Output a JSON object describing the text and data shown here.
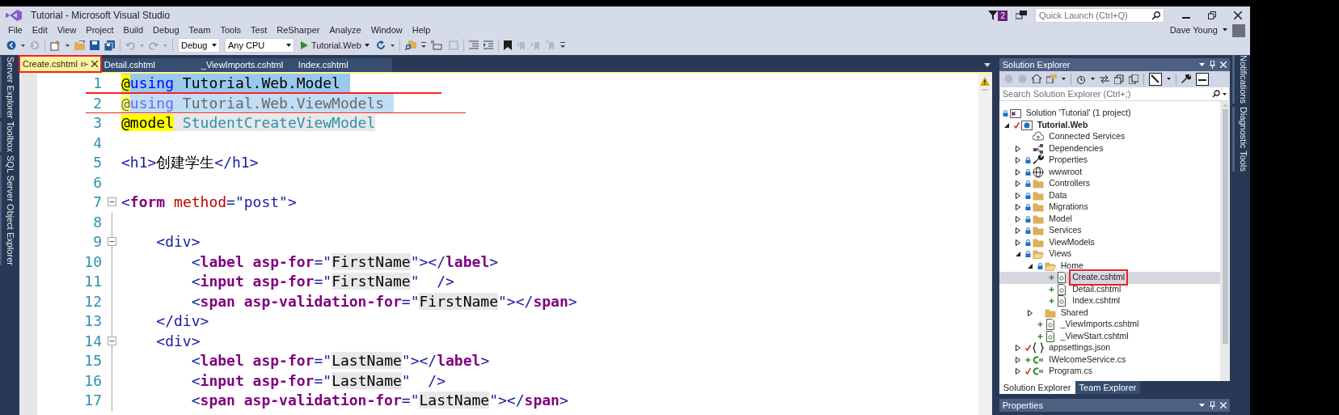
{
  "window": {
    "title": "Tutorial - Microsoft Visual Studio",
    "notification_count": "2",
    "quick_launch": {
      "placeholder": "Quick Launch (Ctrl+Q)"
    },
    "user": "Dave Young"
  },
  "menu": [
    "File",
    "Edit",
    "View",
    "Project",
    "Build",
    "Debug",
    "Team",
    "Tools",
    "Test",
    "ReSharper",
    "Analyze",
    "Window",
    "Help"
  ],
  "toolbar": {
    "configuration": "Debug",
    "platform": "Any CPU",
    "start_target": "Tutorial.Web"
  },
  "left_panels": [
    "Server Explorer",
    "Toolbox",
    "SQL Server Object Explorer"
  ],
  "right_panels": [
    "Notifications",
    "Diagnostic Tools"
  ],
  "tabs": [
    {
      "label": "Create.cshtml",
      "selected": true
    },
    {
      "label": "Detail.cshtml",
      "selected": false
    },
    {
      "label": "_ViewImports.cshtml",
      "selected": false
    },
    {
      "label": "Index.cshtml",
      "selected": false
    }
  ],
  "editor": {
    "lines": [
      {
        "number": "1",
        "selected": true,
        "faded": false,
        "struck": true,
        "fold": false,
        "tokens": [
          {
            "text": "@",
            "kind": "razor"
          },
          {
            "text": "using",
            "kind": "keyword"
          },
          {
            "text": " Tutorial.Web.Model",
            "kind": "plain"
          }
        ]
      },
      {
        "number": "2",
        "selected": true,
        "faded": true,
        "struck": true,
        "fold": false,
        "tokens": [
          {
            "text": "@",
            "kind": "razor"
          },
          {
            "text": "using",
            "kind": "keyword"
          },
          {
            "text": " Tutorial.Web.ViewModels",
            "kind": "plain"
          }
        ]
      },
      {
        "number": "3",
        "selected": false,
        "faded": false,
        "struck": false,
        "fold": false,
        "tokens": [
          {
            "text": "@model",
            "kind": "razor"
          },
          {
            "text": " StudentCreateViewModel",
            "kind": "type"
          }
        ]
      },
      {
        "number": "4",
        "selected": false,
        "faded": false,
        "struck": false,
        "fold": false
      },
      {
        "number": "5",
        "selected": false,
        "faded": false,
        "struck": false,
        "fold": false,
        "tokens": [
          {
            "text": "<h1>",
            "kind": "tag"
          },
          {
            "text": "创建学生",
            "kind": "plain"
          },
          {
            "text": "</h1>",
            "kind": "tag"
          }
        ]
      },
      {
        "number": "6",
        "selected": false,
        "faded": false,
        "struck": false,
        "fold": false
      },
      {
        "number": "7",
        "selected": false,
        "faded": false,
        "struck": false,
        "fold": true,
        "tokens": [
          {
            "text": "<",
            "kind": "tag"
          },
          {
            "text": "form",
            "kind": "helper"
          },
          {
            "text": " method",
            "kind": "attr"
          },
          {
            "text": "=\"post\">",
            "kind": "tag"
          }
        ]
      },
      {
        "number": "8",
        "selected": false,
        "faded": false,
        "struck": false,
        "fold": false
      },
      {
        "number": "9",
        "selected": false,
        "faded": false,
        "struck": false,
        "fold": true,
        "tokens": [
          {
            "text": "    <div>",
            "kind": "tag"
          }
        ]
      },
      {
        "number": "10",
        "selected": false,
        "faded": false,
        "struck": false,
        "fold": false,
        "tokens": [
          {
            "text": "        <",
            "kind": "tag"
          },
          {
            "text": "label asp-for",
            "kind": "helper"
          },
          {
            "text": "=\"",
            "kind": "tag"
          },
          {
            "text": "FirstName",
            "kind": "value"
          },
          {
            "text": "\"></",
            "kind": "tag"
          },
          {
            "text": "label",
            "kind": "helper"
          },
          {
            "text": ">",
            "kind": "tag"
          }
        ]
      },
      {
        "number": "11",
        "selected": false,
        "faded": false,
        "struck": false,
        "fold": false,
        "tokens": [
          {
            "text": "        <",
            "kind": "tag"
          },
          {
            "text": "input asp-for",
            "kind": "helper"
          },
          {
            "text": "=\"",
            "kind": "tag"
          },
          {
            "text": "FirstName",
            "kind": "value"
          },
          {
            "text": "\"  />",
            "kind": "tag"
          }
        ]
      },
      {
        "number": "12",
        "selected": false,
        "faded": false,
        "struck": false,
        "fold": false,
        "tokens": [
          {
            "text": "        <",
            "kind": "tag"
          },
          {
            "text": "span asp-validation-for",
            "kind": "helper"
          },
          {
            "text": "=\"",
            "kind": "tag"
          },
          {
            "text": "FirstName",
            "kind": "value"
          },
          {
            "text": "\"></",
            "kind": "tag"
          },
          {
            "text": "span",
            "kind": "helper"
          },
          {
            "text": ">",
            "kind": "tag"
          }
        ]
      },
      {
        "number": "13",
        "selected": false,
        "faded": false,
        "struck": false,
        "fold": false,
        "tokens": [
          {
            "text": "    </div>",
            "kind": "tag"
          }
        ]
      },
      {
        "number": "14",
        "selected": false,
        "faded": false,
        "struck": false,
        "fold": true,
        "tokens": [
          {
            "text": "    <div>",
            "kind": "tag"
          }
        ]
      },
      {
        "number": "15",
        "selected": false,
        "faded": false,
        "struck": false,
        "fold": false,
        "tokens": [
          {
            "text": "        <",
            "kind": "tag"
          },
          {
            "text": "label asp-for",
            "kind": "helper"
          },
          {
            "text": "=\"",
            "kind": "tag"
          },
          {
            "text": "LastName",
            "kind": "value"
          },
          {
            "text": "\"></",
            "kind": "tag"
          },
          {
            "text": "label",
            "kind": "helper"
          },
          {
            "text": ">",
            "kind": "tag"
          }
        ]
      },
      {
        "number": "16",
        "selected": false,
        "faded": false,
        "struck": false,
        "fold": false,
        "tokens": [
          {
            "text": "        <",
            "kind": "tag"
          },
          {
            "text": "input asp-for",
            "kind": "helper"
          },
          {
            "text": "=\"",
            "kind": "tag"
          },
          {
            "text": "LastName",
            "kind": "value"
          },
          {
            "text": "\"  />",
            "kind": "tag"
          }
        ]
      },
      {
        "number": "17",
        "selected": false,
        "faded": false,
        "struck": false,
        "fold": false,
        "tokens": [
          {
            "text": "        <",
            "kind": "tag"
          },
          {
            "text": "span asp-validation-for",
            "kind": "helper"
          },
          {
            "text": "=\"",
            "kind": "tag"
          },
          {
            "text": "LastName",
            "kind": "value"
          },
          {
            "text": "\"></",
            "kind": "tag"
          },
          {
            "text": "span",
            "kind": "helper"
          },
          {
            "text": ">",
            "kind": "tag"
          }
        ]
      }
    ]
  },
  "solution_explorer": {
    "title": "Solution Explorer",
    "search": {
      "placeholder": "Search Solution Explorer (Ctrl+;)"
    },
    "tree": [
      {
        "label": "Solution 'Tutorial' (1 project)",
        "kind": "solution",
        "locked": true,
        "added": false,
        "edited": false,
        "selected": false,
        "children": [
          {
            "label": "Tutorial.Web",
            "kind": "project",
            "locked": false,
            "added": false,
            "edited": true,
            "expanded": true,
            "selected": false,
            "children": [
              {
                "label": "Connected Services",
                "kind": "cloud",
                "locked": false,
                "added": false,
                "edited": false,
                "selected": false
              },
              {
                "label": "Dependencies",
                "kind": "dependencies",
                "locked": false,
                "added": false,
                "edited": false,
                "expanded": false,
                "selected": false
              },
              {
                "label": "Properties",
                "kind": "wrench",
                "locked": true,
                "added": false,
                "edited": false,
                "expanded": false,
                "selected": false
              },
              {
                "label": "wwwroot",
                "kind": "globe",
                "locked": true,
                "added": false,
                "edited": false,
                "expanded": false,
                "selected": false
              },
              {
                "label": "Controllers",
                "kind": "folder",
                "locked": true,
                "added": false,
                "edited": false,
                "expanded": false,
                "selected": false
              },
              {
                "label": "Data",
                "kind": "folder",
                "locked": true,
                "added": false,
                "edited": false,
                "expanded": false,
                "selected": false
              },
              {
                "label": "Migrations",
                "kind": "folder",
                "locked": true,
                "added": false,
                "edited": false,
                "expanded": false,
                "selected": false
              },
              {
                "label": "Model",
                "kind": "folder",
                "locked": true,
                "added": false,
                "edited": false,
                "expanded": false,
                "selected": false
              },
              {
                "label": "Services",
                "kind": "folder",
                "locked": true,
                "added": false,
                "edited": false,
                "expanded": false,
                "selected": false
              },
              {
                "label": "ViewModels",
                "kind": "folder",
                "locked": true,
                "added": false,
                "edited": false,
                "expanded": false,
                "selected": false
              },
              {
                "label": "Views",
                "kind": "folder",
                "locked": true,
                "added": false,
                "edited": false,
                "expanded": true,
                "selected": false,
                "children": [
                  {
                    "label": "Home",
                    "kind": "folder",
                    "locked": true,
                    "added": false,
                    "edited": false,
                    "expanded": true,
                    "selected": false,
                    "children": [
                      {
                        "label": "Create.cshtml",
                        "kind": "razor",
                        "locked": false,
                        "added": true,
                        "edited": false,
                        "selected": true
                      },
                      {
                        "label": "Detail.cshtml",
                        "kind": "razor",
                        "locked": false,
                        "added": true,
                        "edited": false,
                        "selected": false
                      },
                      {
                        "label": "Index.cshtml",
                        "kind": "razor",
                        "locked": false,
                        "added": true,
                        "edited": false,
                        "selected": false
                      }
                    ]
                  },
                  {
                    "label": "Shared",
                    "kind": "folder",
                    "locked": false,
                    "added": false,
                    "edited": false,
                    "expanded": false,
                    "selected": false
                  },
                  {
                    "label": "_ViewImports.cshtml",
                    "kind": "razor",
                    "locked": false,
                    "added": true,
                    "edited": false,
                    "selected": false
                  },
                  {
                    "label": "_ViewStart.cshtml",
                    "kind": "razor",
                    "locked": false,
                    "added": true,
                    "edited": false,
                    "selected": false
                  }
                ]
              },
              {
                "label": "appsettings.json",
                "kind": "json",
                "locked": false,
                "added": false,
                "edited": true,
                "expanded": false,
                "selected": false
              },
              {
                "label": "IWelcomeService.cs",
                "kind": "csharp",
                "locked": false,
                "added": true,
                "edited": false,
                "expanded": false,
                "selected": false
              },
              {
                "label": "Program.cs",
                "kind": "csharp",
                "locked": false,
                "added": false,
                "edited": true,
                "expanded": false,
                "selected": false
              }
            ]
          }
        ]
      }
    ],
    "bottom_tabs": [
      {
        "label": "Solution Explorer",
        "selected": true
      },
      {
        "label": "Team Explorer",
        "selected": false
      }
    ]
  },
  "properties_panel": {
    "title": "Properties"
  }
}
